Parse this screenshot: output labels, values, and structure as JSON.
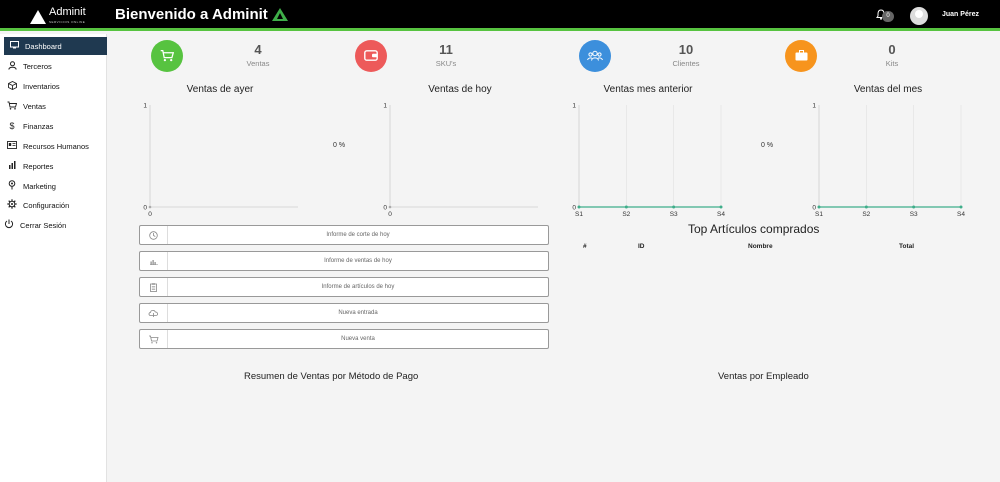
{
  "header": {
    "logo_text": "Adminit",
    "logo_sub": "SERVICIOS ONLINE",
    "welcome": "Bienvenido a Adminit",
    "notifications": "0",
    "user_name": "Juan Pérez"
  },
  "sidebar": {
    "items": [
      {
        "label": "Dashboard",
        "icon": "monitor-icon"
      },
      {
        "label": "Terceros",
        "icon": "user-icon"
      },
      {
        "label": "Inventarios",
        "icon": "box-icon"
      },
      {
        "label": "Ventas",
        "icon": "cart-icon"
      },
      {
        "label": "Finanzas",
        "icon": "dollar-icon"
      },
      {
        "label": "Recursos Humanos",
        "icon": "id-card-icon"
      },
      {
        "label": "Reportes",
        "icon": "bar-chart-icon"
      },
      {
        "label": "Marketing",
        "icon": "pin-icon"
      },
      {
        "label": "Configuración",
        "icon": "gear-icon"
      },
      {
        "label": "Cerrar Sesión",
        "icon": "power-icon"
      }
    ]
  },
  "stats": [
    {
      "value": "4",
      "label": "Ventas",
      "color": "#57c340",
      "icon": "cart-icon"
    },
    {
      "value": "11",
      "label": "SKU's",
      "color": "#ed5a5a",
      "icon": "wallet-icon"
    },
    {
      "value": "10",
      "label": "Clientes",
      "color": "#3c8fdc",
      "icon": "users-icon"
    },
    {
      "value": "0",
      "label": "Kits",
      "color": "#f7941d",
      "icon": "briefcase-icon"
    }
  ],
  "charts": {
    "ayer": {
      "title": "Ventas de ayer",
      "percent": "0 %"
    },
    "hoy": {
      "title": "Ventas de hoy"
    },
    "mes_anterior": {
      "title": "Ventas mes anterior",
      "percent": "0 %"
    },
    "mes": {
      "title": "Ventas del mes"
    }
  },
  "chart_data": [
    {
      "type": "scatter",
      "title": "Ventas de ayer",
      "x": [
        0
      ],
      "y": [
        0
      ],
      "ylim": [
        0,
        1
      ],
      "yticks": [
        "1",
        "0"
      ],
      "xticks": [
        "0"
      ]
    },
    {
      "type": "scatter",
      "title": "Ventas de hoy",
      "x": [
        0
      ],
      "y": [
        0
      ],
      "ylim": [
        0,
        1
      ],
      "yticks": [
        "1",
        "0"
      ],
      "xticks": [
        "0"
      ]
    },
    {
      "type": "line",
      "title": "Ventas mes anterior",
      "categories": [
        "S1",
        "S2",
        "S3",
        "S4"
      ],
      "values": [
        0,
        0,
        0,
        0
      ],
      "ylim": [
        0,
        1
      ],
      "yticks": [
        "1",
        "0"
      ],
      "color": "#3fae8a"
    },
    {
      "type": "line",
      "title": "Ventas del mes",
      "categories": [
        "S1",
        "S2",
        "S3",
        "S4"
      ],
      "values": [
        0,
        0,
        0,
        0
      ],
      "ylim": [
        0,
        1
      ],
      "yticks": [
        "1",
        "0"
      ],
      "color": "#3fae8a"
    }
  ],
  "reports": [
    {
      "label": "Informe de corte de hoy",
      "icon": "clock-icon"
    },
    {
      "label": "Informe de ventas de hoy",
      "icon": "bar-chart-icon"
    },
    {
      "label": "Informe de artículos de hoy",
      "icon": "clipboard-icon"
    },
    {
      "label": "Nueva entrada",
      "icon": "cloud-icon"
    },
    {
      "label": "Nueva venta",
      "icon": "cart-icon"
    }
  ],
  "top_articles": {
    "title": "Top Artículos comprados",
    "columns": [
      "#",
      "ID",
      "Nombre",
      "Total"
    ]
  },
  "bottom": {
    "payment_title": "Resumen de Ventas por Método de Pago",
    "employee_title": "Ventas por Empleado"
  }
}
